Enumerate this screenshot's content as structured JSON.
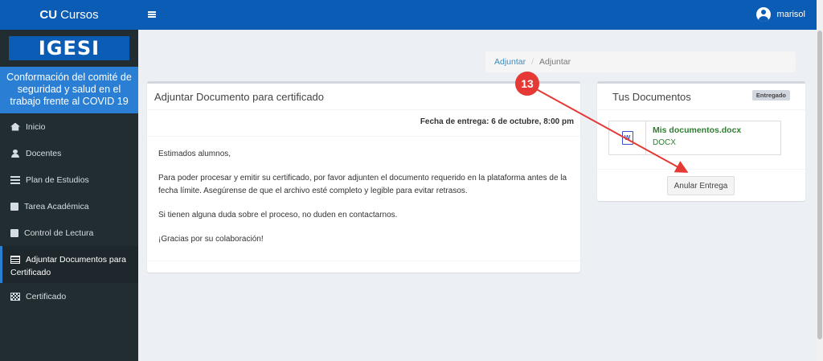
{
  "app": {
    "brand_bold": "CU",
    "brand_rest": "Cursos",
    "logo_text": "IGESI"
  },
  "course_title": "Conformación del comité de seguridad y salud en el trabajo frente al COVID 19",
  "sidebar": {
    "items": [
      {
        "label": "Inicio",
        "icon": "home-icon"
      },
      {
        "label": "Docentes",
        "icon": "user-icon"
      },
      {
        "label": "Plan de Estudios",
        "icon": "list-icon"
      },
      {
        "label": "Tarea Académica",
        "icon": "book-icon"
      },
      {
        "label": "Control de Lectura",
        "icon": "book-icon"
      },
      {
        "label_line1": "Adjuntar Documentos para",
        "label_line2": "Certificado",
        "icon": "table-icon",
        "active": true
      },
      {
        "label": "Certificado",
        "icon": "qr-icon"
      }
    ]
  },
  "header": {
    "username": "marisol"
  },
  "breadcrumb": {
    "link": "Adjuntar",
    "current": "Adjuntar"
  },
  "main": {
    "title": "Adjuntar Documento para certificado",
    "due_date": "Fecha de entrega: 6 de octubre, 8:00 pm",
    "paragraphs": [
      "Estimados alumnos,",
      "Para poder procesar y emitir su certificado, por favor adjunten el documento requerido en la plataforma antes de la fecha límite. Asegúrense de que el archivo esté completo y legible para evitar retrasos.",
      "Si tienen alguna duda sobre el proceso, no duden en contactarnos.",
      "¡Gracias por su colaboración!"
    ]
  },
  "documents": {
    "title": "Tus Documentos",
    "badge": "Entregado",
    "file_name": "Mis documentos.docx",
    "file_type": "DOCX",
    "icon_letter": "W",
    "button_label": "Anular Entrega"
  },
  "annotation": {
    "number": "13",
    "color": "#e53935"
  },
  "colors": {
    "primary": "#0a5cb5",
    "sidebar_bg": "#222d32",
    "accent": "#2a7fd4",
    "file_green": "#2e7d32"
  }
}
